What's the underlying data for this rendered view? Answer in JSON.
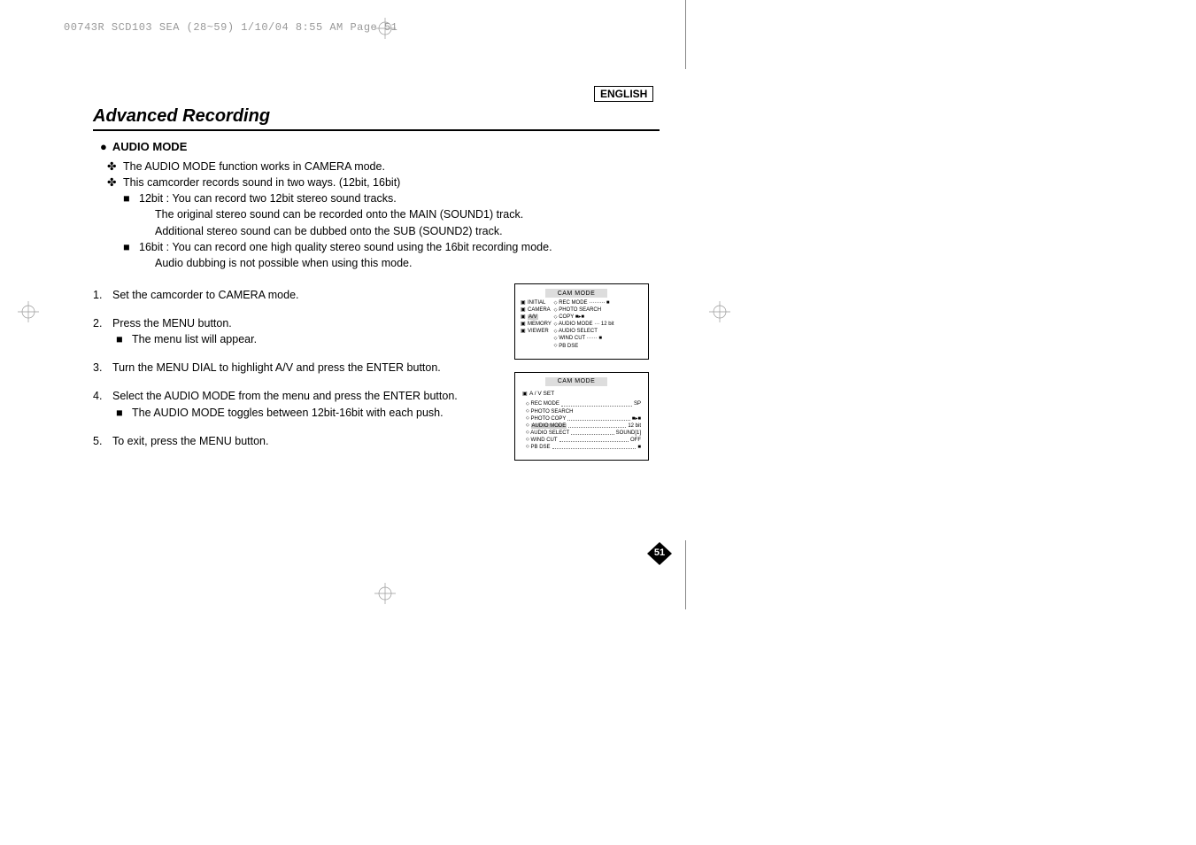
{
  "header": "00743R SCD103 SEA (28~59)  1/10/04 8:55 AM  Page 51",
  "language_badge": "ENGLISH",
  "section_title": "Advanced Recording",
  "audio_mode_heading": "AUDIO MODE",
  "intro": {
    "line1": "The AUDIO MODE function works in CAMERA mode.",
    "line2": "This camcorder records sound in two ways. (12bit, 16bit)",
    "bit12_label": "12bit :",
    "bit12_a": "You can record two 12bit stereo sound tracks.",
    "bit12_b": "The original stereo sound can be recorded onto the MAIN (SOUND1) track.",
    "bit12_c": "Additional stereo sound can be dubbed onto the SUB (SOUND2) track.",
    "bit16_label": "16bit :",
    "bit16_a": "You can record one high quality stereo sound using the 16bit recording mode.",
    "bit16_b": "Audio dubbing is not possible when using this mode."
  },
  "steps": {
    "s1": "Set the camcorder to CAMERA mode.",
    "s2": "Press the MENU button.",
    "s2a": "The menu list will appear.",
    "s3": "Turn the MENU DIAL to highlight A/V and press the ENTER button.",
    "s4": "Select the AUDIO MODE from the menu and press the ENTER button.",
    "s4a": "The AUDIO MODE toggles between 12bit-16bit with each push.",
    "s5": "To exit, press the MENU button."
  },
  "screen1": {
    "title": "CAM MODE",
    "left": [
      "INITIAL",
      "CAMERA",
      "A/V",
      "MEMORY",
      "VIEWER"
    ],
    "right": [
      {
        "label": "REC MODE",
        "val": "■"
      },
      {
        "label": "PHOTO SEARCH",
        "val": ""
      },
      {
        "label": "COPY",
        "val": "■▸■"
      },
      {
        "label": "AUDIO MODE",
        "val": "12 bit"
      },
      {
        "label": "AUDIO SELECT",
        "val": ""
      },
      {
        "label": "WIND CUT",
        "val": "■"
      },
      {
        "label": "PB DSE",
        "val": ""
      }
    ]
  },
  "screen2": {
    "title": "CAM MODE",
    "subset": "A / V SET",
    "lines": [
      {
        "label": "REC MODE",
        "val": "SP"
      },
      {
        "label": "PHOTO SEARCH",
        "val": ""
      },
      {
        "label": "PHOTO COPY",
        "val": "■▸■"
      },
      {
        "label": "AUDIO MODE",
        "val": "12 bit"
      },
      {
        "label": "AUDIO SELECT",
        "val": "SOUND[1]"
      },
      {
        "label": "WIND CUT",
        "val": "OFF"
      },
      {
        "label": "PB DSE",
        "val": "■"
      }
    ]
  },
  "page_number": "51"
}
